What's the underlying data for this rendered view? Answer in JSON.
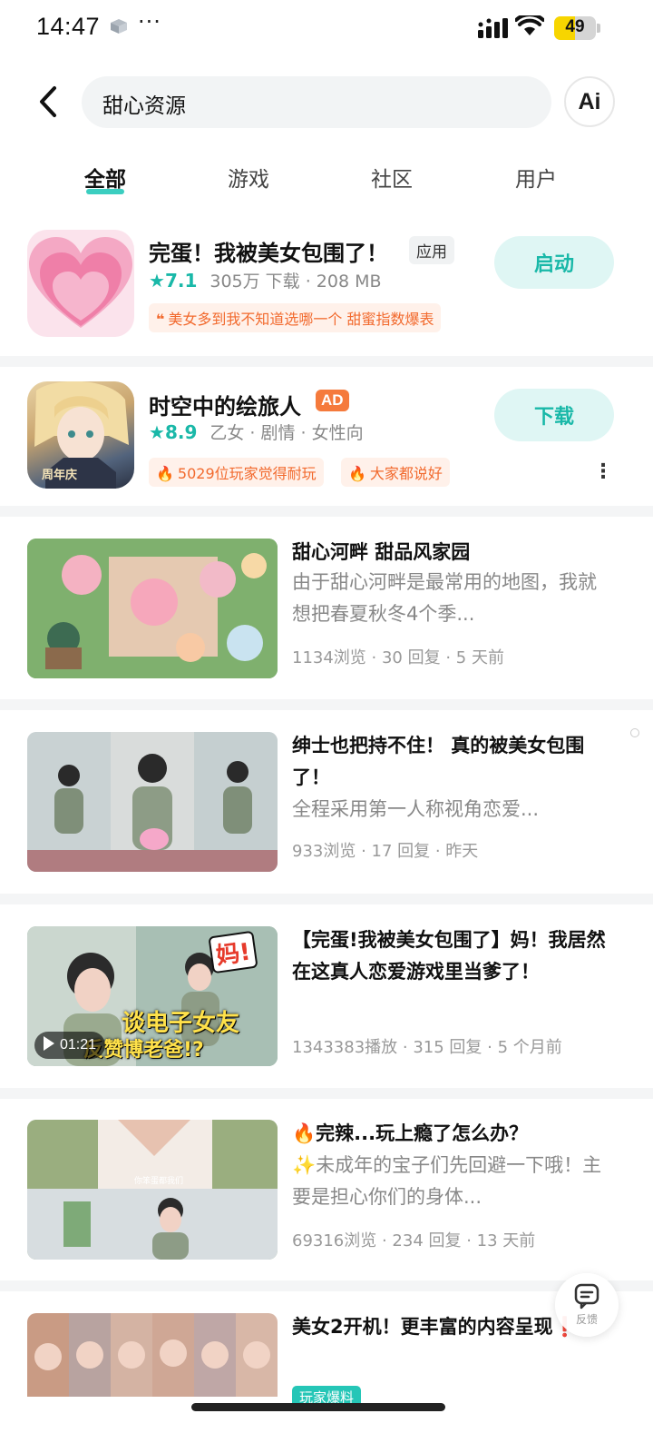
{
  "status_bar": {
    "time": "14:47",
    "extra": "···",
    "battery": "49",
    "battery_level": 0.49
  },
  "header": {
    "search_query": "甜心资源",
    "ai_label": "Ai"
  },
  "tabs": [
    {
      "label": "全部",
      "active": true
    },
    {
      "label": "游戏",
      "active": false
    },
    {
      "label": "社区",
      "active": false
    },
    {
      "label": "用户",
      "active": false
    }
  ],
  "apps": [
    {
      "title": "完蛋！我被美女包围了！",
      "tag": "应用",
      "score": "7.1",
      "meta": "305万 下载 · 208 MB",
      "highlights": [
        {
          "icon": "quote-icon",
          "text": "美女多到我不知道选哪一个 甜蜜指数爆表"
        }
      ],
      "button": "启动"
    },
    {
      "title": "时空中的绘旅人",
      "tag": "AD",
      "score": "8.9",
      "meta": "乙女 · 剧情 · 女性向",
      "highlights": [
        {
          "icon": "flame-icon",
          "text": "5029位玩家觉得耐玩"
        },
        {
          "icon": "flame-icon",
          "text": "大家都说好"
        }
      ],
      "button": "下载",
      "icon_caption": "周年庆"
    }
  ],
  "posts": [
    {
      "title": "甜心河畔 甜品风家园",
      "desc": "由于甜心河畔是最常用的地图，我就想把春夏秋冬4个季...",
      "meta": "1134浏览 · 30 回复 · 5 天前"
    },
    {
      "title": "绅士也把持不住！ 真的被美女包围了！",
      "desc": "全程采用第一人称视角恋爱...",
      "meta": "933浏览 · 17 回复 · 昨天"
    },
    {
      "title": "【完蛋!我被美女包围了】妈！我居然在这真人恋爱游戏里当爹了！",
      "desc": "",
      "meta": "1343383播放 · 315 回复 · 5 个月前",
      "duration": "01:21",
      "overlay_top": "妈!",
      "overlay_mid": "谈电子女友",
      "overlay_bot": "反赞博老爸!?"
    },
    {
      "title": "🔥完辣...玩上瘾了怎么办？",
      "desc": "✨未成年的宝子们先回避一下哦！主要是担心你们的身体...",
      "meta": "69316浏览 · 234 回复 · 13 天前",
      "thumb_caption": "你笨蛋都我们"
    },
    {
      "title": "美女2开机！更丰富的内容呈现❗",
      "desc": "",
      "meta": "",
      "tag": "玩家爆料"
    }
  ],
  "feedback": {
    "label": "反馈"
  },
  "colors": {
    "accent": "#19b8a8",
    "orange": "#f26a2e",
    "divider": "#f4f5f6"
  }
}
